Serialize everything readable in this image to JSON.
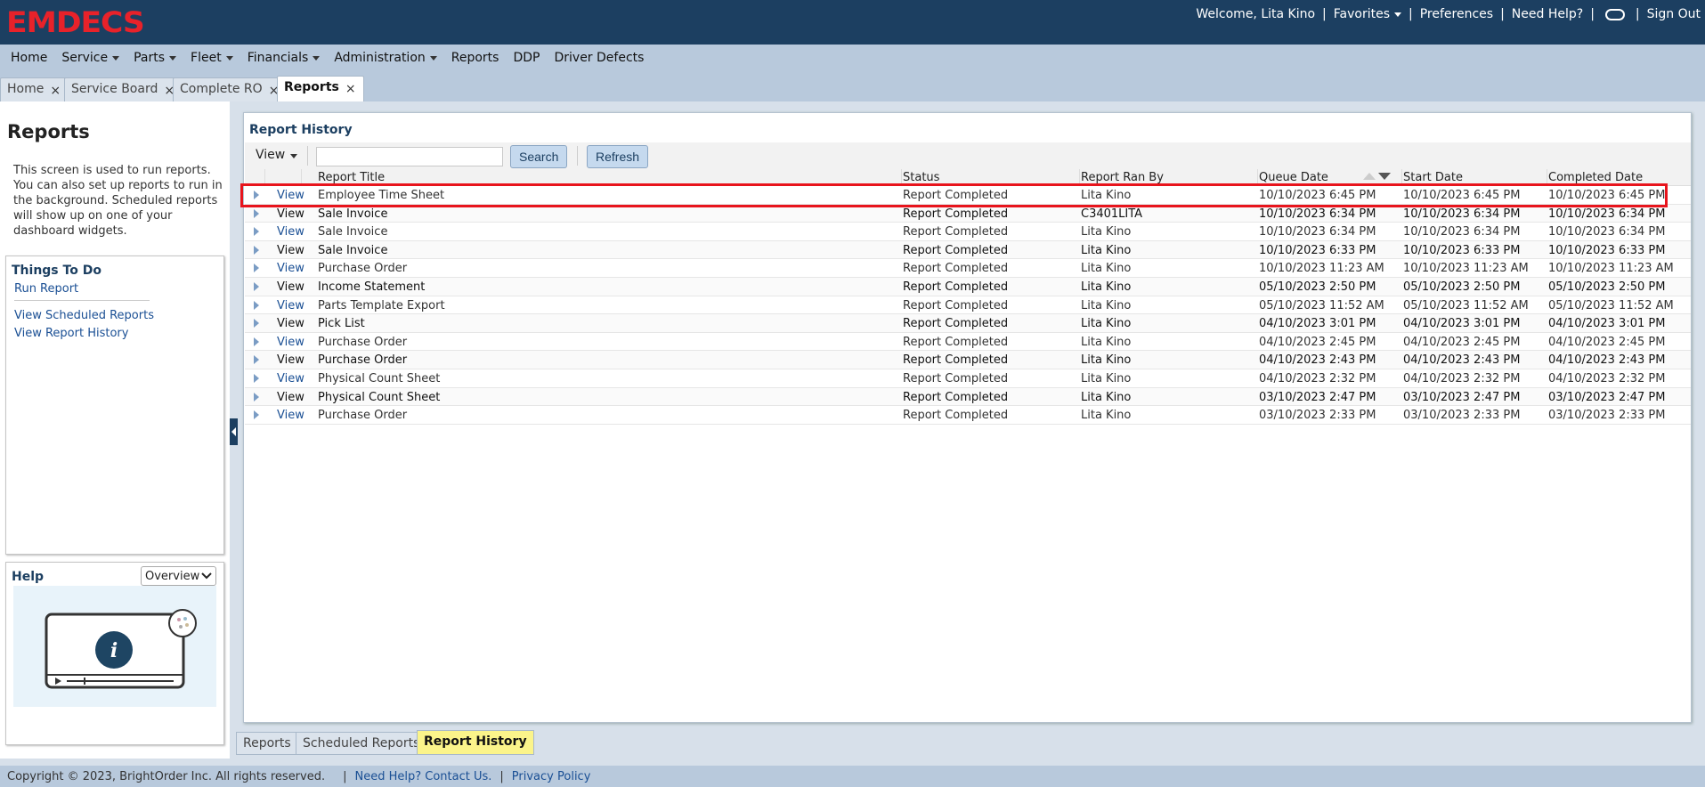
{
  "header": {
    "logo": "EMDECS",
    "welcome": "Welcome, Lita Kino",
    "favorites": "Favorites",
    "preferences": "Preferences",
    "need_help": "Need Help?",
    "sign_out": "Sign Out"
  },
  "menu": {
    "items": [
      {
        "label": "Home",
        "dropdown": false
      },
      {
        "label": "Service",
        "dropdown": true
      },
      {
        "label": "Parts",
        "dropdown": true
      },
      {
        "label": "Fleet",
        "dropdown": true
      },
      {
        "label": "Financials",
        "dropdown": true
      },
      {
        "label": "Administration",
        "dropdown": true
      },
      {
        "label": "Reports",
        "dropdown": false
      },
      {
        "label": "DDP",
        "dropdown": false
      },
      {
        "label": "Driver Defects",
        "dropdown": false
      }
    ]
  },
  "tabs": [
    {
      "label": "Home",
      "active": false
    },
    {
      "label": "Service Board",
      "active": false
    },
    {
      "label": "Complete RO",
      "active": false
    },
    {
      "label": "Reports",
      "active": true
    }
  ],
  "left": {
    "title": "Reports",
    "description": "This screen is used to run reports. You can also set up reports to run in the background. Scheduled reports will show up on one of your dashboard widgets.",
    "todo_title": "Things To Do",
    "todo_links": [
      "Run Report",
      "View Scheduled Reports",
      "View Report History"
    ],
    "help_title": "Help",
    "help_select": "Overview"
  },
  "report_history": {
    "title": "Report History",
    "view_label": "View",
    "search_value": "",
    "search_button": "Search",
    "refresh_button": "Refresh",
    "columns": [
      "Report Title",
      "Status",
      "Report Ran By",
      "Queue Date",
      "Start Date",
      "Completed Date"
    ],
    "rows": [
      {
        "link": "View",
        "title": "Employee Time Sheet",
        "status": "Report Completed",
        "by": "Lita Kino",
        "queue": "10/10/2023 6:45 PM",
        "start": "10/10/2023 6:45 PM",
        "completed": "10/10/2023 6:45 PM",
        "bold": false
      },
      {
        "link": "View",
        "title": "Sale Invoice",
        "status": "Report Completed",
        "by": "C3401LITA",
        "queue": "10/10/2023 6:34 PM",
        "start": "10/10/2023 6:34 PM",
        "completed": "10/10/2023 6:34 PM",
        "bold": true
      },
      {
        "link": "View",
        "title": "Sale Invoice",
        "status": "Report Completed",
        "by": "Lita Kino",
        "queue": "10/10/2023 6:34 PM",
        "start": "10/10/2023 6:34 PM",
        "completed": "10/10/2023 6:34 PM",
        "bold": false
      },
      {
        "link": "View",
        "title": "Sale Invoice",
        "status": "Report Completed",
        "by": "Lita Kino",
        "queue": "10/10/2023 6:33 PM",
        "start": "10/10/2023 6:33 PM",
        "completed": "10/10/2023 6:33 PM",
        "bold": true
      },
      {
        "link": "View",
        "title": "Purchase Order",
        "status": "Report Completed",
        "by": "Lita Kino",
        "queue": "10/10/2023 11:23 AM",
        "start": "10/10/2023 11:23 AM",
        "completed": "10/10/2023 11:23 AM",
        "bold": false
      },
      {
        "link": "View",
        "title": "Income Statement",
        "status": "Report Completed",
        "by": "Lita Kino",
        "queue": "05/10/2023 2:50 PM",
        "start": "05/10/2023 2:50 PM",
        "completed": "05/10/2023 2:50 PM",
        "bold": true
      },
      {
        "link": "View",
        "title": "Parts Template Export",
        "status": "Report Completed",
        "by": "Lita Kino",
        "queue": "05/10/2023 11:52 AM",
        "start": "05/10/2023 11:52 AM",
        "completed": "05/10/2023 11:52 AM",
        "bold": false
      },
      {
        "link": "View",
        "title": "Pick List",
        "status": "Report Completed",
        "by": "Lita Kino",
        "queue": "04/10/2023 3:01 PM",
        "start": "04/10/2023 3:01 PM",
        "completed": "04/10/2023 3:01 PM",
        "bold": true
      },
      {
        "link": "View",
        "title": "Purchase Order",
        "status": "Report Completed",
        "by": "Lita Kino",
        "queue": "04/10/2023 2:45 PM",
        "start": "04/10/2023 2:45 PM",
        "completed": "04/10/2023 2:45 PM",
        "bold": false
      },
      {
        "link": "View",
        "title": "Purchase Order",
        "status": "Report Completed",
        "by": "Lita Kino",
        "queue": "04/10/2023 2:43 PM",
        "start": "04/10/2023 2:43 PM",
        "completed": "04/10/2023 2:43 PM",
        "bold": true
      },
      {
        "link": "View",
        "title": "Physical Count Sheet",
        "status": "Report Completed",
        "by": "Lita Kino",
        "queue": "04/10/2023 2:32 PM",
        "start": "04/10/2023 2:32 PM",
        "completed": "04/10/2023 2:32 PM",
        "bold": false
      },
      {
        "link": "View",
        "title": "Physical Count Sheet",
        "status": "Report Completed",
        "by": "Lita Kino",
        "queue": "03/10/2023 2:47 PM",
        "start": "03/10/2023 2:47 PM",
        "completed": "03/10/2023 2:47 PM",
        "bold": true
      },
      {
        "link": "View",
        "title": "Purchase Order",
        "status": "Report Completed",
        "by": "Lita Kino",
        "queue": "03/10/2023 2:33 PM",
        "start": "03/10/2023 2:33 PM",
        "completed": "03/10/2023 2:33 PM",
        "bold": false
      }
    ]
  },
  "bottom_tabs": [
    {
      "label": "Reports",
      "active": false
    },
    {
      "label": "Scheduled Reports",
      "active": false
    },
    {
      "label": "Report History",
      "active": true
    }
  ],
  "footer": {
    "copyright": "Copyright © 2023, BrightOrder Inc. All rights reserved.",
    "help_link": "Need Help? Contact Us.",
    "privacy_link": "Privacy Policy"
  },
  "colors": {
    "header_bg": "#1c3f61",
    "logo": "#e8222a",
    "highlight": "#e8141c",
    "active_bottom_tab": "#fbf48a"
  }
}
